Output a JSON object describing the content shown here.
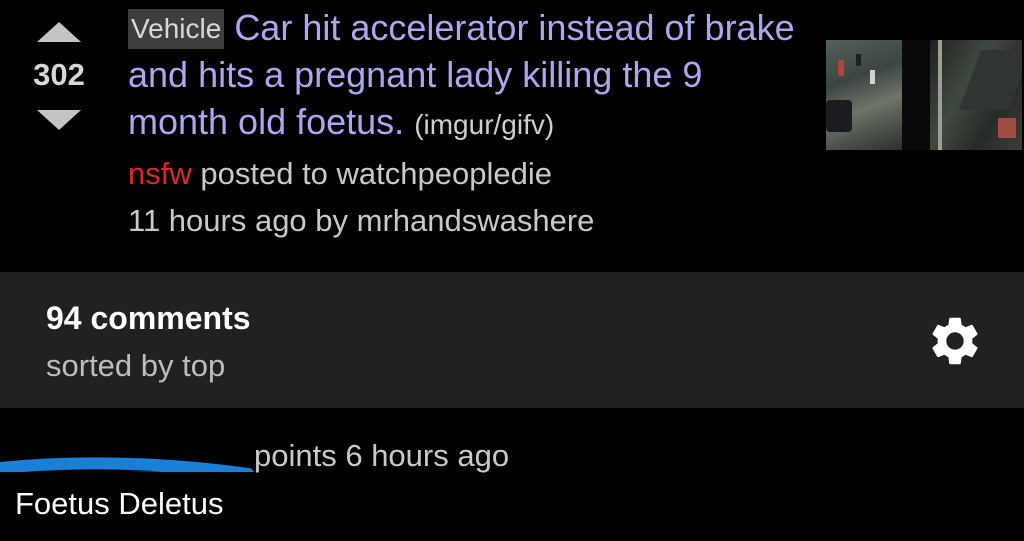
{
  "post": {
    "score": "302",
    "flair": "Vehicle",
    "title": "Car hit accelerator instead of brake and hits a pregnant lady killing the 9 month old foetus.",
    "domain": "(imgur/gifv)",
    "nsfw_label": "nsfw",
    "posted_to": "posted to watchpeopledie",
    "age_author": "11 hours ago by mrhandswashere",
    "icons": {
      "upvote": "arrow-up-icon",
      "downvote": "arrow-down-icon"
    }
  },
  "comments_header": {
    "count": "94 comments",
    "sort": "sorted by top",
    "settings_icon": "gear-icon"
  },
  "comment": {
    "meta": "points 6 hours ago",
    "body": "Foetus Deletus"
  },
  "colors": {
    "title": "#a9a8f1",
    "nsfw": "#e0252b",
    "bar_bg": "#212121",
    "redaction": "#1a7fd6"
  }
}
